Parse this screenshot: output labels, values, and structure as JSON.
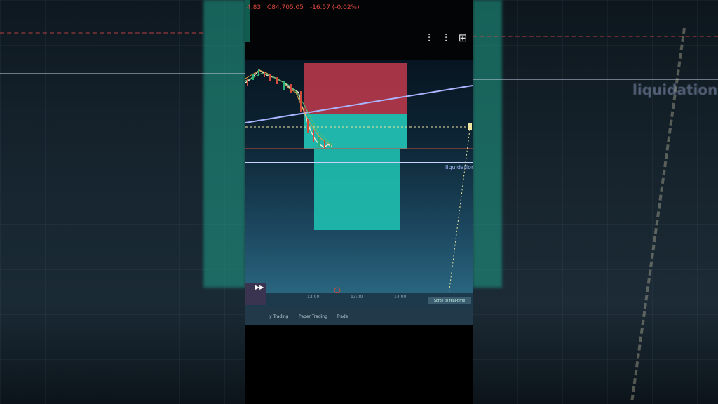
{
  "ticker": {
    "prev": "4.83",
    "price": "C84,705.05",
    "change": "-16.57 (-0.02%)"
  },
  "toolbar": {
    "icons": [
      "settings-sliders-icon",
      "settings-sliders-alt-icon",
      "grid-layout-icon"
    ]
  },
  "chart": {
    "liquidation_label": "liquidation",
    "time_labels": [
      "12:00",
      "13:00",
      "14:00"
    ],
    "scroll_button": "Scroll to real-time"
  },
  "bottom_tabs": {
    "tab1": "y Trading",
    "tab2": "Paper Trading",
    "tab3": "Trade"
  },
  "background": {
    "liquidation_blur": "liquidation"
  },
  "colors": {
    "stop_zone": "#c23a4e",
    "target_zone": "#1fbfb0",
    "trend_line": "#aab4ff",
    "liquidation_line": "#c9d0ff",
    "price_dash": "#f0e6a0",
    "red_line": "#d24a3c"
  }
}
